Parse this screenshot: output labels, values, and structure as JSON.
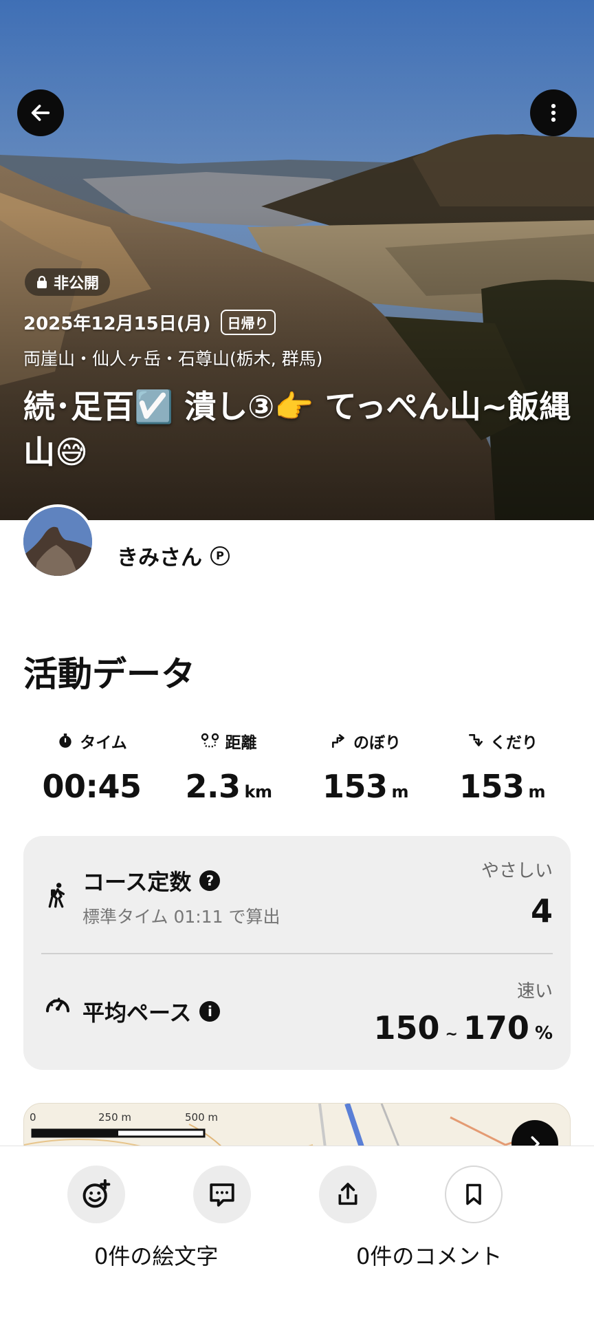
{
  "header": {
    "visibility_badge": "非公開",
    "date": "2025年12月15日(月)",
    "trip_type": "日帰り",
    "area": "両崖山・仙人ヶ岳・石尊山(栃木, 群馬)",
    "title": "続･足百☑️ 潰し③👉 てっぺん山~飯縄山😅",
    "icons": {
      "back": "arrow-left-icon",
      "more": "more-vertical-icon",
      "lock": "lock-icon"
    }
  },
  "user": {
    "name": "きみさん",
    "badge": "P"
  },
  "activity": {
    "section_title": "活動データ",
    "stats": [
      {
        "label": "タイム",
        "value": "00:45",
        "unit": "",
        "icon": "stopwatch-icon"
      },
      {
        "label": "距離",
        "value": "2.3",
        "unit": "km",
        "icon": "route-icon"
      },
      {
        "label": "のぼり",
        "value": "153",
        "unit": "m",
        "icon": "ascent-icon"
      },
      {
        "label": "くだり",
        "value": "153",
        "unit": "m",
        "icon": "descent-icon"
      }
    ]
  },
  "course": {
    "label": "コース定数",
    "sub": "標準タイム 01:11 で算出",
    "level": "やさしい",
    "value": "4"
  },
  "pace": {
    "label": "平均ペース",
    "level": "速い",
    "min": "150",
    "max": "170",
    "unit": "%"
  },
  "map": {
    "scale_labels": [
      "0",
      "250 m",
      "500 m"
    ]
  },
  "actions": {
    "emoji_count": "0件の絵文字",
    "comment_count": "0件のコメント"
  }
}
